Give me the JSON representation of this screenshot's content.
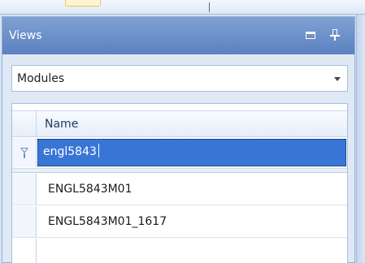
{
  "panel": {
    "title": "Views",
    "maximize_icon": "maximize-icon",
    "pin_icon": "pin-icon"
  },
  "combo": {
    "selected": "Modules"
  },
  "grid": {
    "columns": [
      "Name"
    ],
    "filter_value": "engl5843",
    "filter_icon": "filter-icon",
    "rows": [
      {
        "name": "ENGL5843M01"
      },
      {
        "name": "ENGL5843M01_1617"
      }
    ]
  },
  "colors": {
    "header": "#6b8fca",
    "selection": "#3876d6"
  }
}
